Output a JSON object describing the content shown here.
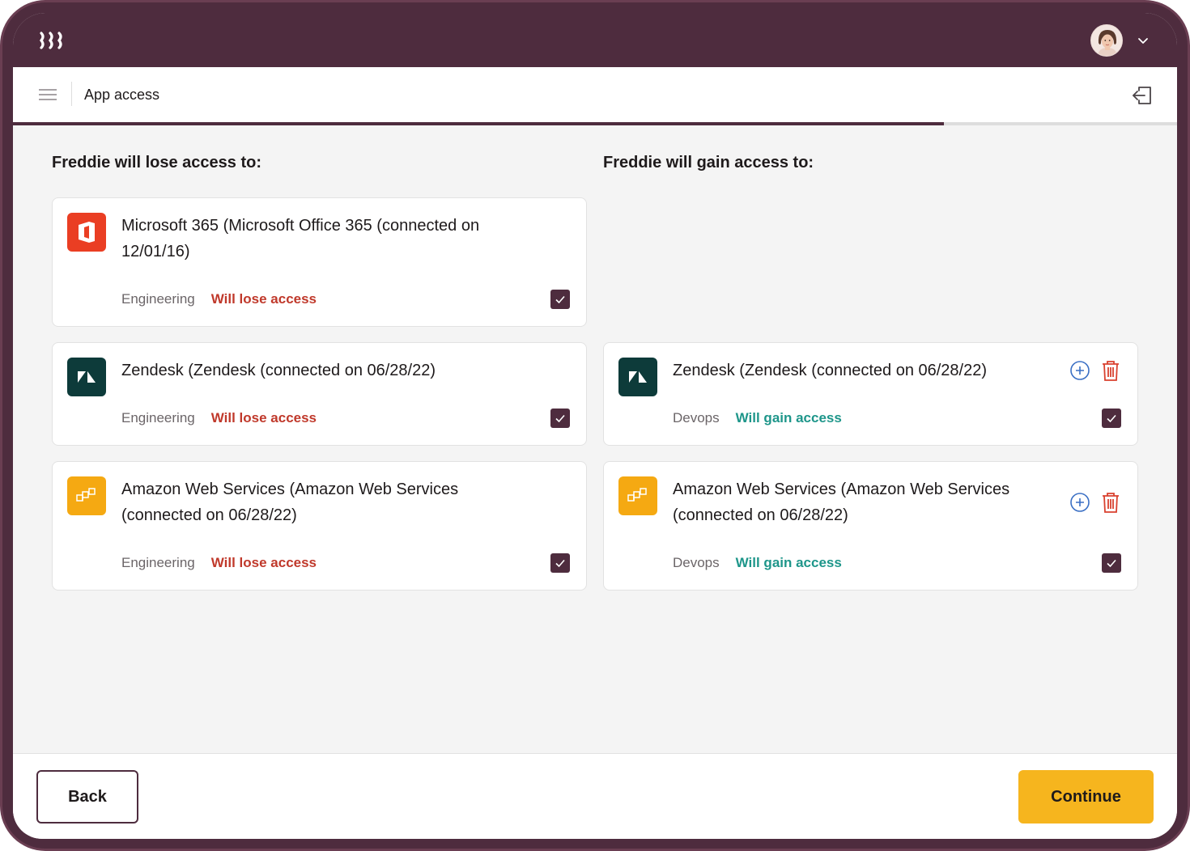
{
  "header": {
    "page_title": "App access"
  },
  "progress": {
    "percent": 80
  },
  "lose_column": {
    "heading": "Freddie will lose access to:",
    "cards": [
      {
        "app": "Microsoft 365 (Microsoft Office 365 (connected on 12/01/16)",
        "icon": "microsoft-office-icon",
        "department": "Engineering",
        "status": "Will lose access",
        "checked": true
      },
      {
        "app": "Zendesk (Zendesk (connected on 06/28/22)",
        "icon": "zendesk-icon",
        "department": "Engineering",
        "status": "Will lose access",
        "checked": true
      },
      {
        "app": "Amazon Web Services (Amazon Web Services (connected on 06/28/22)",
        "icon": "aws-icon",
        "department": "Engineering",
        "status": "Will lose access",
        "checked": true
      }
    ]
  },
  "gain_column": {
    "heading": "Freddie will gain access to:",
    "cards": [
      {
        "app": "Zendesk (Zendesk (connected on 06/28/22)",
        "icon": "zendesk-icon",
        "department": "Devops",
        "status": "Will gain access",
        "checked": true
      },
      {
        "app": "Amazon Web Services (Amazon Web Services (connected on 06/28/22)",
        "icon": "aws-icon",
        "department": "Devops",
        "status": "Will gain access",
        "checked": true
      }
    ]
  },
  "footer": {
    "back_label": "Back",
    "continue_label": "Continue"
  },
  "colors": {
    "brand": "#4e2c3e",
    "accent": "#f6b51e",
    "lose": "#c0392b",
    "gain": "#1e968a"
  }
}
